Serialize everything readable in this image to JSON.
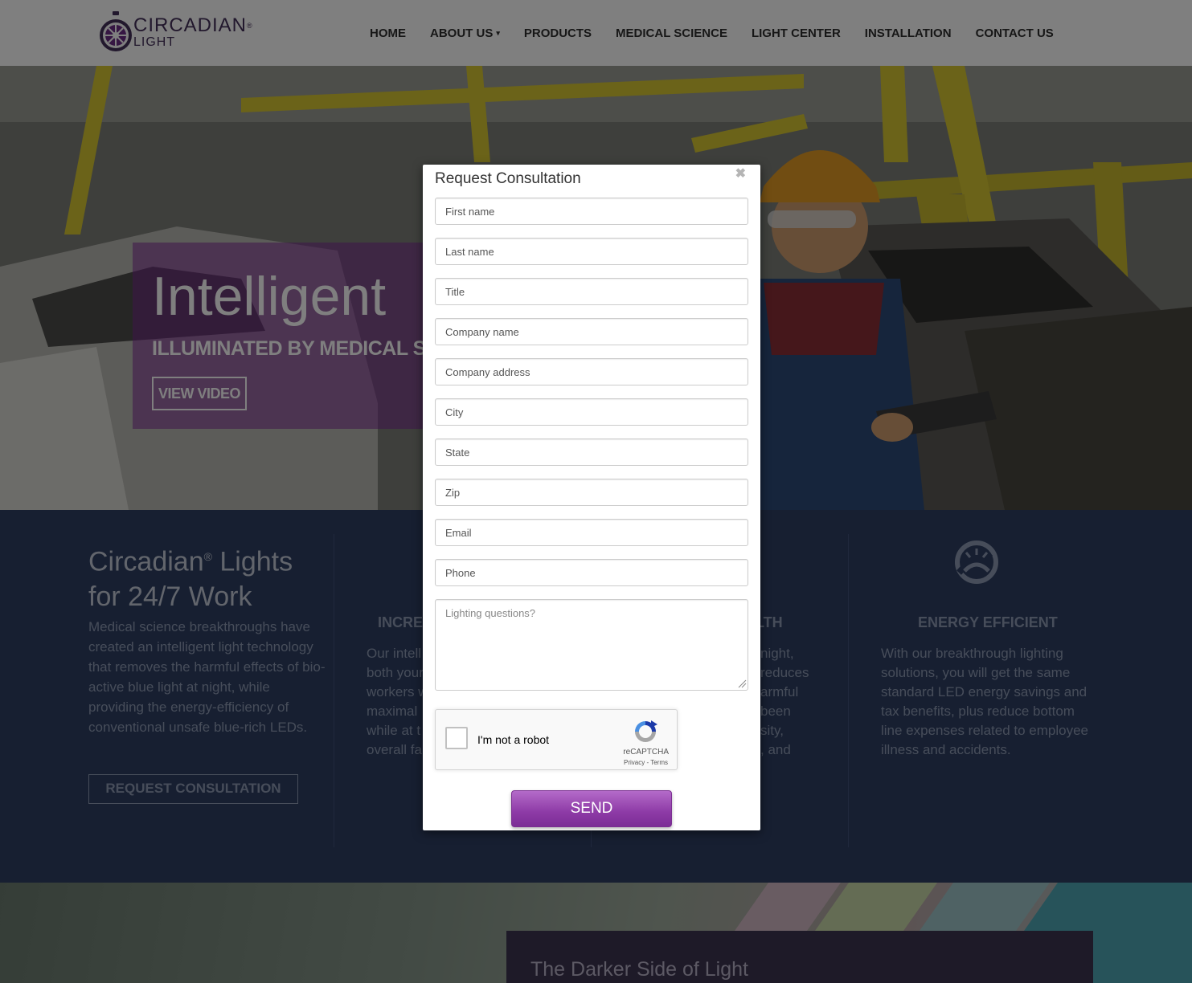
{
  "colors": {
    "brand_purple": "#7c2d96",
    "nav_text": "#2e2e2e",
    "features_bg": "#2e3f63",
    "overlay": "rgba(0,0,0,0.5)"
  },
  "header": {
    "logo": {
      "name": "CIRCADIAN",
      "registered": "®",
      "sub": "LIGHT",
      "icon": "circadian-clock-logo"
    },
    "nav": [
      {
        "label": "HOME"
      },
      {
        "label": "ABOUT US",
        "has_dropdown": true,
        "dropdown_icon": "caret-down-icon",
        "caret": "▾"
      },
      {
        "label": "PRODUCTS"
      },
      {
        "label": "MEDICAL SCIENCE"
      },
      {
        "label": "LIGHT CENTER"
      },
      {
        "label": "INSTALLATION"
      },
      {
        "label": "CONTACT US"
      }
    ]
  },
  "hero": {
    "title": "Intelligent",
    "subtitle": "ILLUMINATED BY MEDICAL SC",
    "button": "VIEW VIDEO"
  },
  "features": {
    "intro": {
      "title_line1_a": "Circadian",
      "title_reg": "®",
      "title_line1_b": " Lights",
      "title_line2": "for 24/7 Work",
      "text": "Medical science breakthroughs have created an intelligent light technology that removes the harmful effects of bio-active blue light at night, while providing the energy-efficiency of conventional unsafe blue-rich LEDs.",
      "button": "REQUEST CONSULTATION"
    },
    "columns": [
      {
        "heading": "INCREA",
        "lines": [
          "Our intell",
          "both your",
          "workers w",
          "maximal",
          "while at t",
          "overall fa"
        ]
      },
      {
        "heading": "LTH",
        "lines": [
          "night,",
          "reduces",
          "armful",
          "been",
          "sity,",
          ", and"
        ]
      },
      {
        "heading": "ENERGY EFFICIENT",
        "icon": "energy-gauge-icon",
        "text": "With our breakthrough lighting solutions, you will get the same standard LED energy savings and tax benefits, plus reduce bottom line expenses related to employee illness and accidents."
      }
    ]
  },
  "bottom": {
    "panel_title": "The Darker Side of Light"
  },
  "modal": {
    "title": "Request Consultation",
    "close_icon": "close-icon",
    "close_glyph": "✖",
    "fields": [
      {
        "placeholder": "First name"
      },
      {
        "placeholder": "Last name"
      },
      {
        "placeholder": "Title"
      },
      {
        "placeholder": "Company name"
      },
      {
        "placeholder": "Company address"
      },
      {
        "placeholder": "City"
      },
      {
        "placeholder": "State"
      },
      {
        "placeholder": "Zip"
      },
      {
        "placeholder": "Email"
      },
      {
        "placeholder": "Phone"
      }
    ],
    "textarea_placeholder": "Lighting questions?",
    "recaptcha": {
      "label": "I'm not a robot",
      "brand": "reCAPTCHA",
      "links": "Privacy - Terms",
      "icon": "recaptcha-logo-icon"
    },
    "send_label": "SEND"
  }
}
